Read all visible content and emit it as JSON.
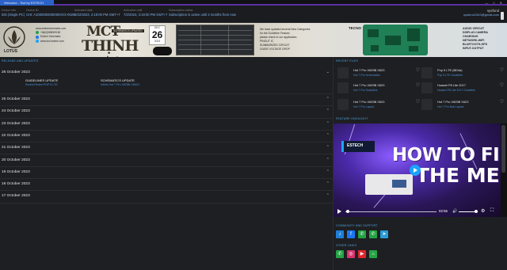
{
  "window": {
    "tab_title": "Welcome - Tool by ESTECH",
    "controls": [
      "—",
      "□",
      "✕"
    ],
    "accent": "#2b63c9"
  },
  "account": {
    "fields": [
      {
        "label": "Device Info",
        "value": "ID5 (Single PC)"
      },
      {
        "label": "Device ID",
        "value": "CHI: A1000000000000XXX-0028"
      },
      {
        "label": "Activated date",
        "value": "8/22/2023, 2:19:00 PM GMT+7"
      },
      {
        "label": "Activation until",
        "value": "7/2/2024, 3:19:00 PM GMT+7"
      },
      {
        "label": "Subscription status",
        "value": "Subscription is active until 2 months from now"
      }
    ],
    "username": "sysforul",
    "email": "sysforul1343@gmail.com"
  },
  "banner": {
    "brand_word": "LOTUS",
    "contact_lines": [
      "www.estechschematic.com",
      "+84(0)988009180",
      "Estech Schematic",
      "www.tool.estech.com"
    ],
    "title_line1": "MCT",
    "title_line2": "THỊNH VƯỢNG",
    "title_tag": "SCHEMATICS UPDATED",
    "calendar": {
      "month": "DEC",
      "day": "26",
      "year": "2023"
    },
    "notice_lines": [
      "We have updated several New Categories",
      "for the Guideline Feature,",
      "please check in our application.",
      "PINOUT IC",
      "SUMMARIZED CIRCUIT",
      "GUIDE VOLTAGE DROP"
    ],
    "tecno": "TECNO",
    "feature_lines": [
      "AUDIO CIRCUIT",
      "DISPLAY-CAMERA",
      "CHARGING",
      "NETWORK-WIFI",
      "BLUETOOTH-GPS",
      "INPUT-OUTPUT"
    ]
  },
  "updates": {
    "title": "RELEASE AND UPDATES",
    "expanded": {
      "date": "26 October 2023",
      "guideline_header": "GUIDELINES UPDATE",
      "guideline_link": "Redmi Redmi POP 5 LTE",
      "schematics_header": "SCHEMATICS UPDATE",
      "schematics_link": "Infinix Hot 7 Pro X625B X6623"
    },
    "collapsed_dates": [
      "25 October 2023",
      "24 October 2023",
      "23 October 2023",
      "22 October 2023",
      "21 October 2023",
      "20 October 2023",
      "19 October 2023",
      "18 October 2023",
      "17 October 2023"
    ],
    "chevron_down": "⌄",
    "chevron_up": "⌃"
  },
  "recent": {
    "title": "RECENT FILES",
    "items": [
      {
        "name": "Hot 7 Pro X625B X623",
        "sub": "Hot 7 Pro Schematics"
      },
      {
        "name": "Pop 5 LTE (BD4a)",
        "sub": "Pop 5 LTE Guideline"
      },
      {
        "name": "Hot 7 Pro X625B X623",
        "sub": "Hot 7 Pro Guideline"
      },
      {
        "name": "Huawei P8 Lite 2017",
        "sub": "Huawei P8 Lite 2017 Guideline"
      },
      {
        "name": "Hot 7 Pro X625B X623",
        "sub": "Hot 7 Pro Layout"
      },
      {
        "name": "Hot 7 Pro X625B X623",
        "sub": "Hot 7 Pro Bott Layout"
      }
    ]
  },
  "feature": {
    "title": "FEATURE HIGHLIGHT",
    "video_line1": "HOW TO FIND",
    "video_line2": "THE MENU",
    "brand": "ESTECH",
    "time": "02:55",
    "progress": 0.02,
    "volume": 0.9
  },
  "community": {
    "title": "COMMUNITY AND SUPPORT",
    "buttons": [
      {
        "name": "tiktok-icon",
        "glyph": "♪",
        "color": "#1f7fd6"
      },
      {
        "name": "facebook-icon",
        "glyph": "f",
        "color": "#1877f2"
      },
      {
        "name": "whatsapp-icon",
        "glyph": "✆",
        "color": "#25a244"
      },
      {
        "name": "whatsapp-group-icon",
        "glyph": "✆",
        "color": "#25a244"
      },
      {
        "name": "telegram-icon",
        "glyph": "➤",
        "color": "#2a9bd8"
      }
    ]
  },
  "other": {
    "title": "OTHER LINKS",
    "buttons": [
      {
        "name": "whatsapp-link-icon",
        "glyph": "✆",
        "color": "#25a244"
      },
      {
        "name": "instagram-icon",
        "glyph": "◎",
        "color": "#d6336c"
      },
      {
        "name": "youtube-icon",
        "glyph": "▶",
        "color": "#e0262a"
      },
      {
        "name": "shop-icon",
        "glyph": "⌂",
        "color": "#25a244"
      }
    ]
  }
}
